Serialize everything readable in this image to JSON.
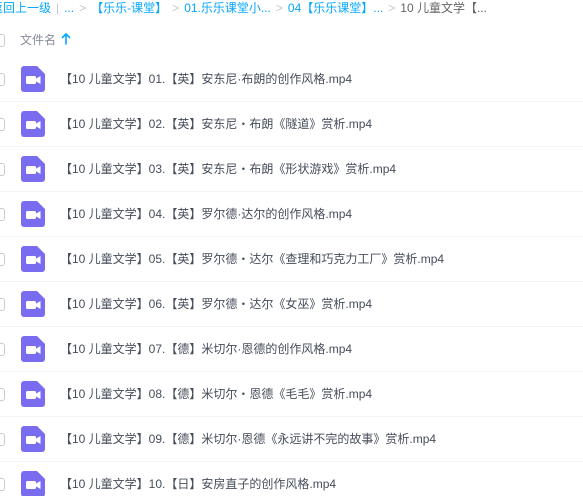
{
  "breadcrumb": {
    "back": "返回上一级",
    "sep": "|",
    "ellipsis": "...",
    "items": [
      "【乐乐-课堂】",
      "01.乐乐课堂小...",
      "04【乐乐课堂】..."
    ],
    "current": "10 儿童文学【..."
  },
  "list_header": {
    "name_label": "文件名",
    "sort_icon": "arrow-up-icon"
  },
  "file_icon": "video-file-icon",
  "colors": {
    "accent": "#06a7ff",
    "video_icon": "#7a6cf0"
  },
  "files": [
    {
      "name": "【10 儿童文学】01.【英】安东尼·布朗的创作风格.mp4"
    },
    {
      "name": "【10 儿童文学】02.【英】安东尼・布朗《隧道》赏析.mp4"
    },
    {
      "name": "【10 儿童文学】03.【英】安东尼・布朗《形状游戏》赏析.mp4"
    },
    {
      "name": "【10 儿童文学】04.【英】罗尔德·达尔的创作风格.mp4"
    },
    {
      "name": "【10 儿童文学】05.【英】罗尔德・达尔《查理和巧克力工厂》赏析.mp4"
    },
    {
      "name": "【10 儿童文学】06.【英】罗尔德・达尔《女巫》赏析.mp4"
    },
    {
      "name": "【10 儿童文学】07.【德】米切尔·恩德的创作风格.mp4"
    },
    {
      "name": "【10 儿童文学】08.【德】米切尔・恩德《毛毛》赏析.mp4"
    },
    {
      "name": "【10 儿童文学】09.【德】米切尔·恩德《永远讲不完的故事》赏析.mp4"
    },
    {
      "name": "【10 儿童文学】10.【日】安房直子的创作风格.mp4"
    }
  ]
}
